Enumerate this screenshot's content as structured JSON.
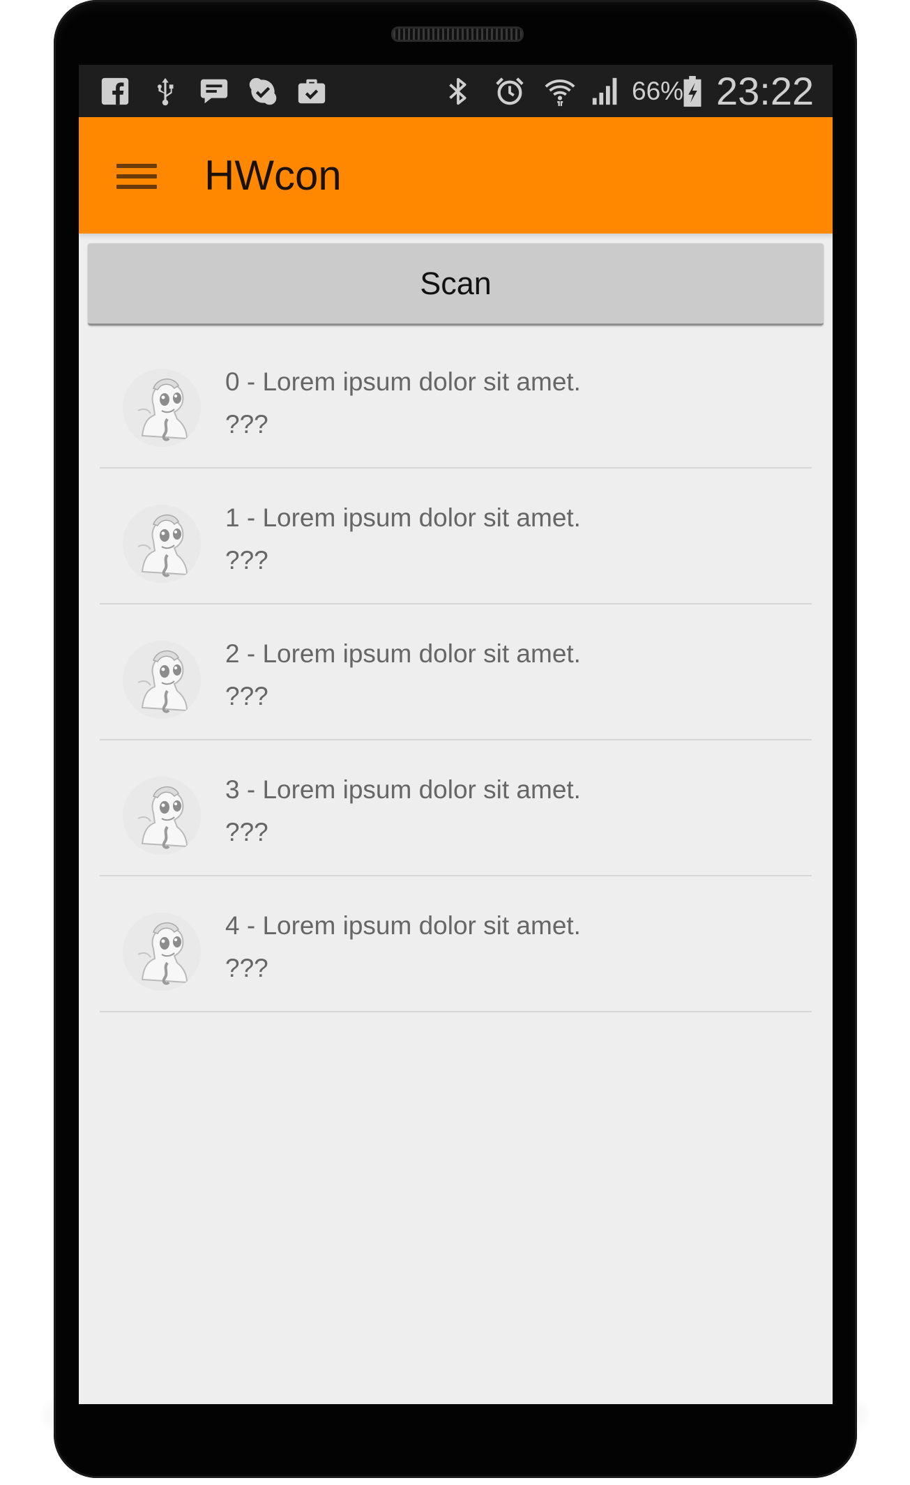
{
  "status_bar": {
    "left_icons": [
      "facebook-icon",
      "usb-icon",
      "chat-icon",
      "skype-icon",
      "briefcase-check-icon"
    ],
    "right_icons": [
      "bluetooth-icon",
      "alarm-icon",
      "wifi-icon",
      "signal-icon"
    ],
    "battery_percent": "66%",
    "battery_state": "charging",
    "time": "23:22"
  },
  "app_bar": {
    "title": "HWcon",
    "background_color": "#ff8800",
    "menu_icon": "hamburger-menu-icon"
  },
  "scan_button": {
    "label": "Scan"
  },
  "devices": [
    {
      "title": "0 - Lorem ipsum dolor sit amet.",
      "subtitle": "???",
      "avatar": "pony-avatar"
    },
    {
      "title": "1 - Lorem ipsum dolor sit amet.",
      "subtitle": "???",
      "avatar": "pony-avatar"
    },
    {
      "title": "2 - Lorem ipsum dolor sit amet.",
      "subtitle": "???",
      "avatar": "pony-avatar"
    },
    {
      "title": "3 - Lorem ipsum dolor sit amet.",
      "subtitle": "???",
      "avatar": "pony-avatar"
    },
    {
      "title": "4 - Lorem ipsum dolor sit amet.",
      "subtitle": "???",
      "avatar": "pony-avatar"
    }
  ]
}
